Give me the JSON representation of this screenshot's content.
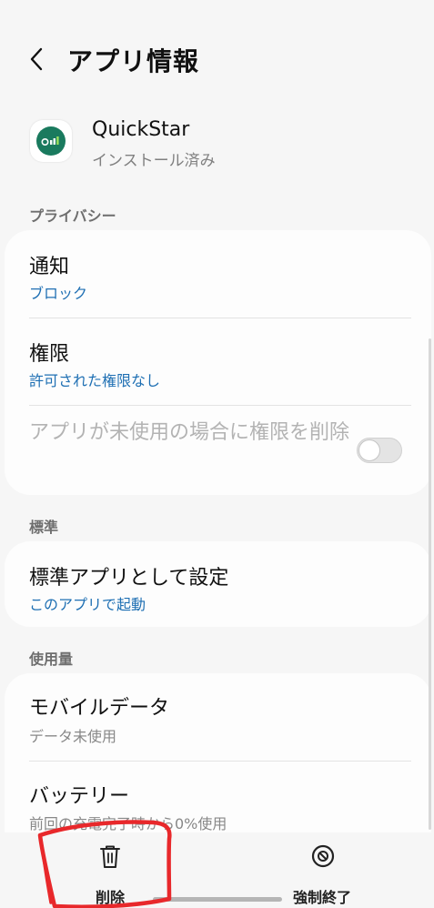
{
  "header": {
    "title": "アプリ情報",
    "back_icon": "chevron-left-icon"
  },
  "app": {
    "name": "QuickStar",
    "status": "インストール済み",
    "icon": "quickstar-app-icon",
    "icon_color": "#1a7a5e"
  },
  "sections": {
    "privacy": "プライバシー",
    "defaults": "標準",
    "usage": "使用量"
  },
  "privacy": {
    "notifications_title": "通知",
    "notifications_value": "ブロック",
    "permissions_title": "権限",
    "permissions_value": "許可された権限なし",
    "remove_perms_label": "アプリが未使用の場合に権限を削除",
    "remove_perms_enabled": false
  },
  "defaults": {
    "set_default_title": "標準アプリとして設定",
    "set_default_value": "このアプリで起動"
  },
  "usage": {
    "mobile_data_title": "モバイルデータ",
    "mobile_data_value": "データ未使用",
    "battery_title": "バッテリー",
    "battery_value": "前回の充電完了時から0%使用"
  },
  "bottom": {
    "uninstall_label": "削除",
    "force_stop_label": "強制終了"
  },
  "colors": {
    "accent": "#1e6fb3",
    "background": "#f6f6f6",
    "card": "#fdfdfd",
    "annotation": "#e8282b"
  }
}
